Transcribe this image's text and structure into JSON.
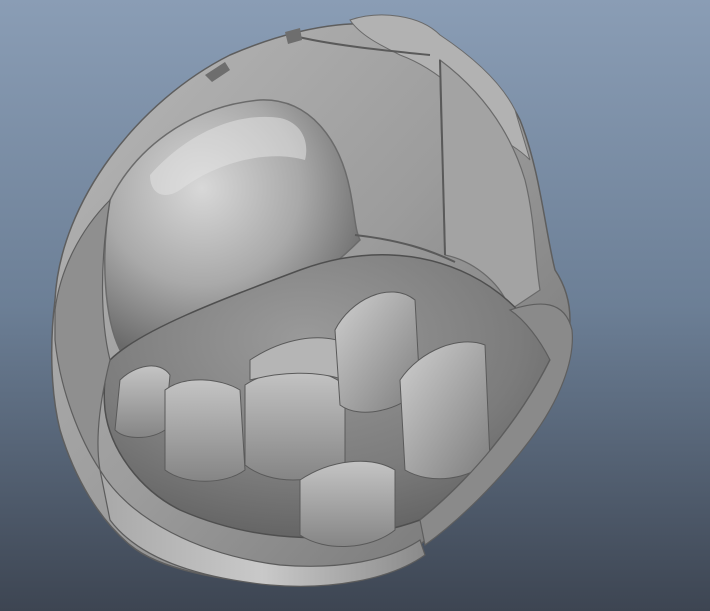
{
  "viewport": {
    "background_top": "#8a9db5",
    "background_mid": "#6c7f96",
    "background_bottom": "#3d4552"
  },
  "model": {
    "base_color": "#9a9a9a",
    "highlight_color": "#d6d6d6",
    "shadow_color": "#4f4f4f"
  }
}
